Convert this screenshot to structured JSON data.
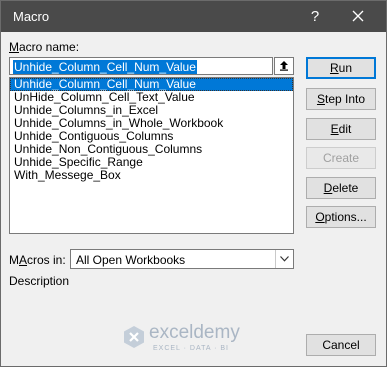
{
  "window": {
    "title": "Macro",
    "help_glyph": "?",
    "close_icon": "close-icon"
  },
  "macro_name": {
    "label_access": "M",
    "label_rest": "acro name:",
    "value": "Unhide_Column_Cell_Num_Value"
  },
  "macros": [
    {
      "label": "Unhide_Column_Cell_Num_Value",
      "selected": true
    },
    {
      "label": "UnHide_Column_Cell_Text_Value",
      "selected": false
    },
    {
      "label": "Unhide_Columns_in_Excel",
      "selected": false
    },
    {
      "label": "Unhide_Columns_in_Whole_Workbook",
      "selected": false
    },
    {
      "label": "Unhide_Contiguous_Columns",
      "selected": false
    },
    {
      "label": "Unhide_Non_Contiguous_Columns",
      "selected": false
    },
    {
      "label": "Unhide_Specific_Range",
      "selected": false
    },
    {
      "label": "With_Messege_Box",
      "selected": false
    }
  ],
  "buttons": {
    "run": {
      "access": "R",
      "rest": "un"
    },
    "step_into": {
      "access": "S",
      "rest": "tep Into"
    },
    "edit": {
      "access": "E",
      "rest": "dit"
    },
    "create": {
      "access": "",
      "rest": "Create"
    },
    "delete": {
      "access": "D",
      "rest": "elete"
    },
    "options": {
      "access": "O",
      "rest": "ptions..."
    },
    "cancel": {
      "access": "",
      "rest": "Cancel"
    }
  },
  "macros_in": {
    "label_access": "A",
    "label_pre": "M",
    "label_rest": "cros in:",
    "value": "All Open Workbooks"
  },
  "description": {
    "label": "Description"
  },
  "watermark": {
    "name": "exceldemy",
    "tagline": "EXCEL · DATA · BI"
  },
  "colors": {
    "titlebar": "#4a4a4a",
    "selection": "#0078d7",
    "dialog_bg": "#f0f0f0"
  }
}
